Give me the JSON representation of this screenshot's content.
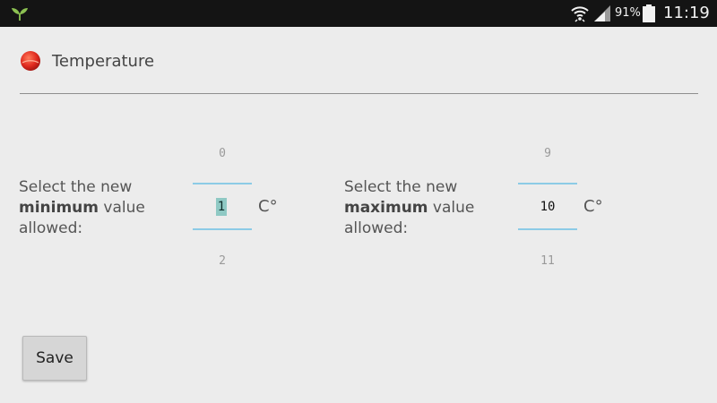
{
  "status_bar": {
    "battery_percent": "91%",
    "time": "11:19",
    "icons": [
      "sprout-app-icon",
      "wifi-icon",
      "signal-icon",
      "battery-icon"
    ]
  },
  "header": {
    "title": "Temperature",
    "icon": "red-ball-icon"
  },
  "min_picker": {
    "prompt_pre": "Select the new",
    "prompt_bold": "minimum",
    "prompt_mid": "value",
    "prompt_post": "allowed:",
    "prev": "0",
    "value": "1",
    "next": "2",
    "unit": "C°"
  },
  "max_picker": {
    "prompt_pre": "Select the new",
    "prompt_bold": "maximum",
    "prompt_mid": "value",
    "prompt_post": "allowed:",
    "prev": "9",
    "value": "10",
    "next": "11",
    "unit": "C°"
  },
  "save_button": {
    "label": "Save"
  },
  "colors": {
    "status_bar": "#141414",
    "background": "#ececec",
    "picker_divider": "#8ccbe6",
    "selection": "#8fc9c4",
    "header_icon": "#e02a1f"
  }
}
